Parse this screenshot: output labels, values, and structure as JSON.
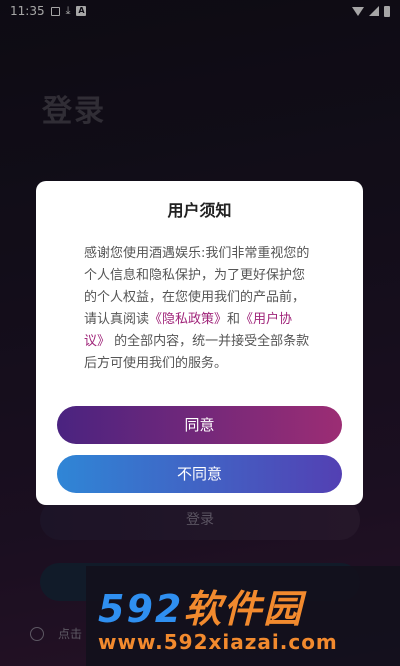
{
  "status_bar": {
    "time": "11:35",
    "icons": [
      "image-icon",
      "download-icon",
      "a-icon",
      "wifi-icon",
      "signal-icon",
      "battery-icon"
    ]
  },
  "background": {
    "title": "登录",
    "login_button": "登录",
    "agree_text": "点击"
  },
  "dialog": {
    "title": "用户须知",
    "body_part1": "感谢您使用酒遇娱乐:我们非常重视您的个人信息和隐私保护，为了更好保护您的个人权益，在您使用我们的产品前，请认真阅读",
    "privacy_link": "《隐私政策》",
    "and_text": "和",
    "agreement_link": "《用户协议》",
    "body_part2": "的全部内容，统一并接受全部条款后方可使用我们的服务。",
    "agree_button": "同意",
    "disagree_button": "不同意"
  },
  "watermark": {
    "logo_num": "592",
    "logo_cn": "软件园",
    "url": "www.592xiazai.com"
  },
  "colors": {
    "link": "#a0257a",
    "agree_gradient": [
      "#4a2380",
      "#9c2d74"
    ],
    "disagree_gradient": [
      "#2f86d6",
      "#5340b3"
    ]
  }
}
